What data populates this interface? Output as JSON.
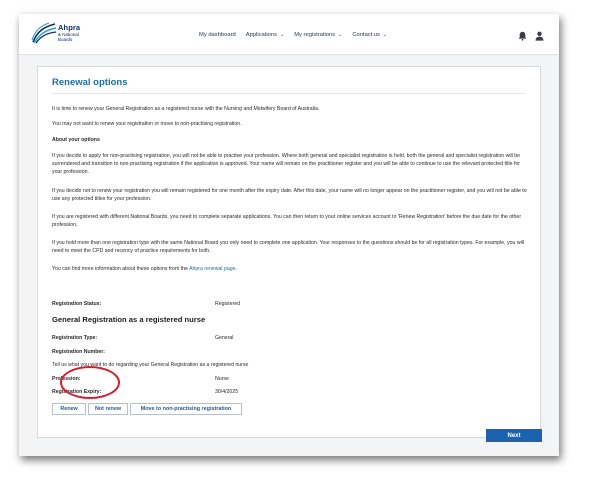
{
  "brand": {
    "name": "Ahpra",
    "subname": "& National Boards",
    "colors": {
      "navy": "#0d2f6b",
      "accent": "#1b6fa8",
      "primary_button": "#1b62b0",
      "highlight": "#d4202c"
    }
  },
  "nav": {
    "items": [
      {
        "label": "My dashboard",
        "has_dropdown": false
      },
      {
        "label": "Applications",
        "has_dropdown": true
      },
      {
        "label": "My registrations",
        "has_dropdown": true
      },
      {
        "label": "Contact us",
        "has_dropdown": true
      }
    ],
    "icons": [
      "bell-icon",
      "user-icon"
    ]
  },
  "page": {
    "title": "Renewal options",
    "intro": "It is time to renew your General Registration as a registered nurse with the Nursing and Midwifery Board of Australia.",
    "intro2": "You may not want to renew your registration or move to non-practising registration.",
    "about_heading": "About your options",
    "para1": "If you decide to apply for non-practising registration, you will not be able to practise your profession. Where both general and specialist registration is held, both the general and specialist registration will be surrendered and transition to non-practising registration if the application is approved. Your name will remain on the practitioner register and you will be able to continue to use the relevant protected title for your profession.",
    "para2": "If you decide not to renew your registration you will remain registered for one month after the expiry date. After this date, your name will no longer appear on the practitioner register, and you will not be able to use any protected titles for your profession.",
    "para3": "If you are registered with different National Boards, you need to complete separate applications. You can then return to your online services account to 'Renew Registration' before the due date for the other profession.",
    "para4": "If you hold more than one registration type with the same National Board you only need to complete one application. Your responses to the questions should be for all registration types. For example, you will need to meet the CPD and recency of practice requirements for both.",
    "more_info_prefix": "You can find more information about these options from the ",
    "more_info_link": "Ahpra renewal page",
    "more_info_suffix": "."
  },
  "registration": {
    "status_label": "Registration Status:",
    "status_value": "Registered",
    "section_title": "General Registration as a registered nurse",
    "type_label": "Registration Type:",
    "type_value": "General",
    "number_label": "Registration Number:",
    "number_value": "",
    "question": "Tell us what you want to do regarding your General Registration as a registered nurse",
    "profession_label": "Profession:",
    "profession_value": "Nurse",
    "expiry_label": "Registration Expiry:",
    "expiry_value": "30/4/2025"
  },
  "actions": {
    "renew": "Renew",
    "not_renew": "Not renew",
    "move": "Move to non-practising registration",
    "next": "Next"
  }
}
